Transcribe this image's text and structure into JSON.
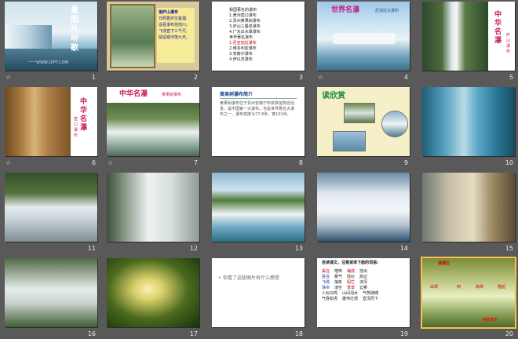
{
  "slides": [
    {
      "number": "1",
      "title": "看图片听歌",
      "url": "一一WWW.1PPT.COM"
    },
    {
      "number": "2",
      "poem": [
        "望庐山瀑布",
        "日照香炉生紫烟,",
        "遥看瀑布挂前川。",
        "飞流直下三千尺,",
        "疑是银河落九天。"
      ]
    },
    {
      "number": "3",
      "lines": [
        "我国著名的瀑布",
        "1.黄河壶口瀑布",
        "2.贵州黄果树瀑布",
        "3.庐山三叠泉瀑布",
        "4.广东白水寨瀑布",
        "世界著名瀑布",
        "1.尼亚加拉瀑布",
        "2.维多利亚瀑布",
        "3.安赫尔瀑布",
        "4.伊瓜苏瀑布"
      ]
    },
    {
      "number": "4",
      "title": "世界名瀑",
      "subtitle": "尼加拉瓜瀑布"
    },
    {
      "number": "5",
      "title": "中华名瀑",
      "subtitle": "庐山瀑布"
    },
    {
      "number": "6",
      "title": "中华名瀑",
      "subtitle": "壶口瀑布"
    },
    {
      "number": "7",
      "title": "中华名瀑",
      "subtitle": "黄果树瀑布"
    },
    {
      "number": "8",
      "title": "黄果树瀑布简介",
      "body": "黄果树瀑布位于贵州省镇宁布依族苗族自治县，是中国第一大瀑布，也是世界著名大瀑布之一。瀑布高度为77.8米，宽101米。"
    },
    {
      "number": "9",
      "title": "读欣赏"
    },
    {
      "number": "10"
    },
    {
      "number": "11"
    },
    {
      "number": "12"
    },
    {
      "number": "13"
    },
    {
      "number": "14"
    },
    {
      "number": "15"
    },
    {
      "number": "16"
    },
    {
      "number": "17"
    },
    {
      "number": "18",
      "question": "你看了这些图片有什么感受"
    },
    {
      "number": "19",
      "heading": "自读课文，注意读准下面的词语:",
      "words": [
        [
          "丢在",
          "喧哗",
          "铺成",
          "挂出"
        ],
        [
          "吞没",
          "雾气",
          "轻纱",
          "高过"
        ],
        [
          "飞溅",
          "抽象",
          "阻拦",
          "流泻"
        ],
        [
          "珠帘",
          "凌空",
          "笼罩",
          "云雾"
        ],
        [
          "人似马鸣",
          "山间泪水",
          "气势磅礴"
        ],
        [
          "气吞如虎",
          "雄伟壮观",
          "直泻而下"
        ]
      ]
    },
    {
      "number": "20",
      "title": "读课文",
      "label": "诗歌赏析",
      "phrases": [
        "出现",
        "到",
        "高高",
        "隆起"
      ]
    }
  ],
  "colors": {
    "background": "#595959",
    "selection": "#f2c14e"
  }
}
